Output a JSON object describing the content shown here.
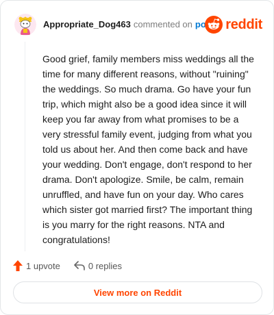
{
  "comment": {
    "username": "Appropriate_Dog463",
    "commented_text": "commented on",
    "post_link": "post",
    "body": "Good grief, family members miss weddings all the time for many different reasons, without \"ruining\" the weddings. So much drama. Go have your fun trip, which might also be a good idea since it will keep you far away from what promises to be a very stressful family event, judging from what you told us about her. And then come back and have your wedding. Don't engage, don't respond to her drama. Don't apologize. Smile, be calm, remain unruffled, and have fun on your day. Who cares which sister got married first? The important thing is you marry for the right reasons. NTA and congratulations!"
  },
  "brand": {
    "logo_text": "reddit",
    "color": "#ff4500"
  },
  "actions": {
    "upvote_label": "1 upvote",
    "replies_label": "0 replies"
  },
  "footer": {
    "view_more_label": "View more on Reddit"
  },
  "icons": {
    "avatar": "snoo-avatar-icon",
    "logo": "reddit-snoo-icon",
    "upvote": "upvote-arrow-icon",
    "reply": "reply-arrow-icon"
  }
}
